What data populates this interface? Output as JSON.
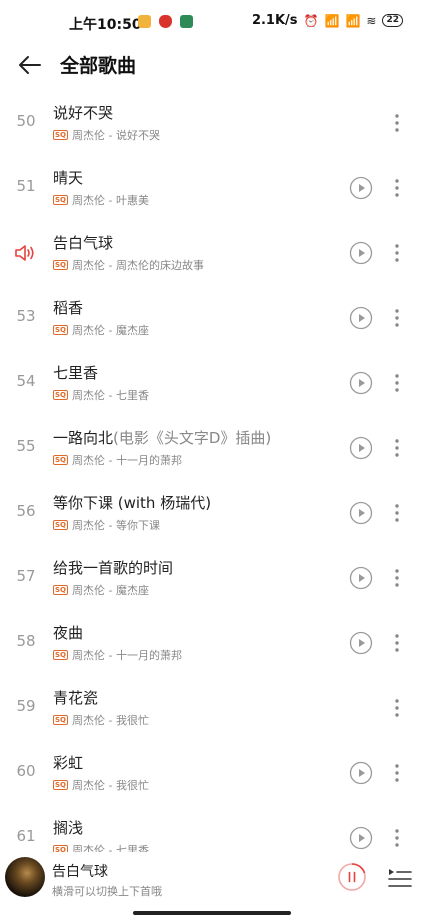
{
  "status_bar": {
    "time": "上午10:50",
    "net_speed": "2.1K/s",
    "alarm": "⏰",
    "signal1": "📶",
    "signal2": "📶",
    "wifi": "≋",
    "battery": "22"
  },
  "header": {
    "title": "全部歌曲"
  },
  "songs": [
    {
      "num": "50",
      "title": "说好不哭",
      "extra": "",
      "badge": "SQ",
      "meta": "周杰伦 - 说好不哭",
      "has_play": false,
      "playing": false
    },
    {
      "num": "51",
      "title": "晴天",
      "extra": "",
      "badge": "SQ",
      "meta": "周杰伦 - 叶惠美",
      "has_play": true,
      "playing": false
    },
    {
      "num": "",
      "title": "告白气球",
      "extra": "",
      "badge": "SQ",
      "meta": "周杰伦 - 周杰伦的床边故事",
      "has_play": true,
      "playing": true
    },
    {
      "num": "53",
      "title": "稻香",
      "extra": "",
      "badge": "SQ",
      "meta": "周杰伦 - 魔杰座",
      "has_play": true,
      "playing": false
    },
    {
      "num": "54",
      "title": "七里香",
      "extra": "",
      "badge": "SQ",
      "meta": "周杰伦 - 七里香",
      "has_play": true,
      "playing": false
    },
    {
      "num": "55",
      "title": "一路向北",
      "extra": "(电影《头文字D》插曲)",
      "badge": "SQ",
      "meta": "周杰伦 - 十一月的萧邦",
      "has_play": true,
      "playing": false
    },
    {
      "num": "56",
      "title": "等你下课 (with 杨瑞代)",
      "extra": "",
      "badge": "SQ",
      "meta": "周杰伦 - 等你下课",
      "has_play": true,
      "playing": false
    },
    {
      "num": "57",
      "title": "给我一首歌的时间",
      "extra": "",
      "badge": "SQ",
      "meta": "周杰伦 - 魔杰座",
      "has_play": true,
      "playing": false
    },
    {
      "num": "58",
      "title": "夜曲",
      "extra": "",
      "badge": "SQ",
      "meta": "周杰伦 - 十一月的萧邦",
      "has_play": true,
      "playing": false
    },
    {
      "num": "59",
      "title": "青花瓷",
      "extra": "",
      "badge": "SQ",
      "meta": "周杰伦 - 我很忙",
      "has_play": false,
      "playing": false
    },
    {
      "num": "60",
      "title": "彩虹",
      "extra": "",
      "badge": "SQ",
      "meta": "周杰伦 - 我很忙",
      "has_play": true,
      "playing": false
    },
    {
      "num": "61",
      "title": "搁浅",
      "extra": "",
      "badge": "SQ",
      "meta": "周杰伦 - 七里香",
      "has_play": true,
      "playing": false
    }
  ],
  "mini_player": {
    "title": "告白气球",
    "subtitle": "横滑可以切换上下首哦"
  },
  "colors": {
    "accent": "#e8413d",
    "sq_badge": "#e06a2a",
    "muted": "#888888"
  },
  "icons": {
    "back": "arrow-left-icon",
    "speaker": "speaker-icon",
    "play": "play-circle-icon",
    "more": "more-vertical-icon",
    "pause": "pause-circle-icon",
    "queue": "playlist-icon"
  }
}
